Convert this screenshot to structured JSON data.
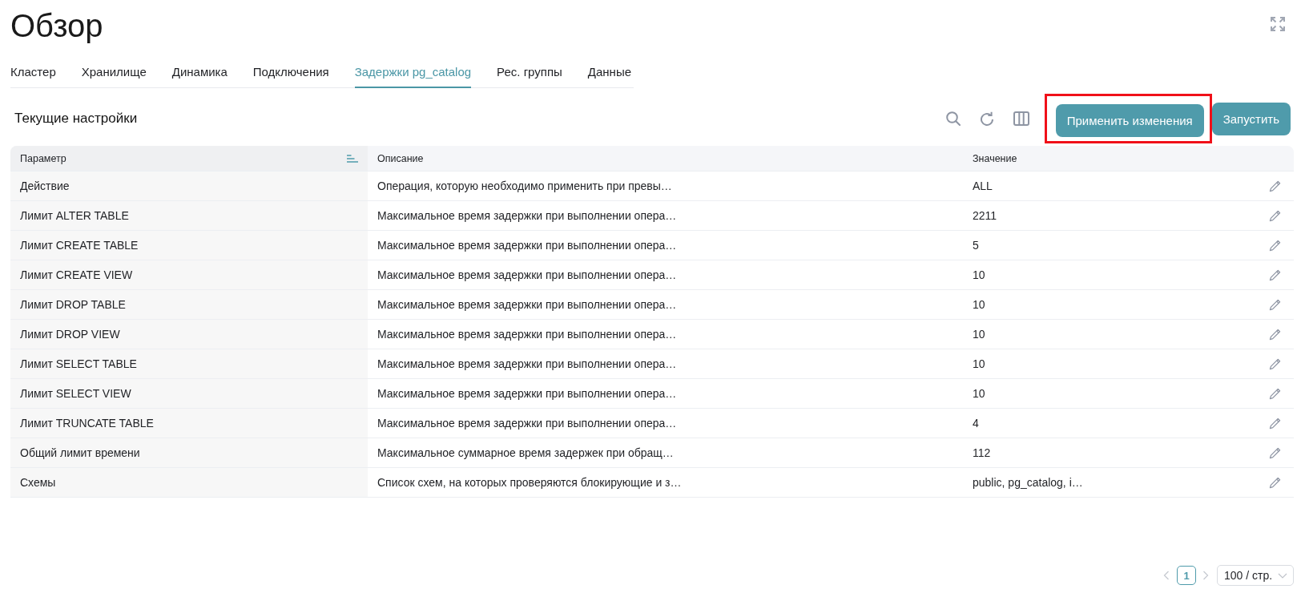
{
  "page": {
    "title": "Обзор"
  },
  "tabs": [
    {
      "label": "Кластер",
      "selected": false
    },
    {
      "label": "Хранилище",
      "selected": false
    },
    {
      "label": "Динамика",
      "selected": false
    },
    {
      "label": "Подключения",
      "selected": false
    },
    {
      "label": "Задержки pg_catalog",
      "selected": true
    },
    {
      "label": "Рес. группы",
      "selected": false
    },
    {
      "label": "Данные",
      "selected": false
    }
  ],
  "section": {
    "title": "Текущие настройки"
  },
  "actions": [
    {
      "label": "Применить изменения",
      "highlighted": true
    },
    {
      "label": "Запустить",
      "highlighted": false
    }
  ],
  "table": {
    "columns": [
      {
        "label": "Параметр",
        "sorted": true
      },
      {
        "label": "Описание",
        "sorted": false
      },
      {
        "label": "Значение",
        "sorted": false
      }
    ],
    "rows": [
      {
        "cells": [
          "Действие",
          "Операция, которую необходимо применить при превы…",
          "ALL"
        ]
      },
      {
        "cells": [
          "Лимит ALTER TABLE",
          "Максимальное время задержки при выполнении опера…",
          "2211"
        ]
      },
      {
        "cells": [
          "Лимит CREATE TABLE",
          "Максимальное время задержки при выполнении опера…",
          "5"
        ]
      },
      {
        "cells": [
          "Лимит CREATE VIEW",
          "Максимальное время задержки при выполнении опера…",
          "10"
        ]
      },
      {
        "cells": [
          "Лимит DROP TABLE",
          "Максимальное время задержки при выполнении опера…",
          "10"
        ]
      },
      {
        "cells": [
          "Лимит DROP VIEW",
          "Максимальное время задержки при выполнении опера…",
          "10"
        ]
      },
      {
        "cells": [
          "Лимит SELECT TABLE",
          "Максимальное время задержки при выполнении опера…",
          "10"
        ]
      },
      {
        "cells": [
          "Лимит SELECT VIEW",
          "Максимальное время задержки при выполнении опера…",
          "10"
        ]
      },
      {
        "cells": [
          "Лимит TRUNCATE TABLE",
          "Максимальное время задержки при выполнении опера…",
          "4"
        ]
      },
      {
        "cells": [
          "Общий лимит времени",
          "Максимальное суммарное время задержек при обращ…",
          "112"
        ]
      },
      {
        "cells": [
          "Схемы",
          "Список схем, на которых проверяются блокирующие и з…",
          "public, pg_catalog, i…"
        ]
      }
    ]
  },
  "pagination": {
    "prev": {
      "disabled": true
    },
    "pages": [
      {
        "label": "1",
        "selected": true
      }
    ],
    "next": {
      "disabled": true
    },
    "page_size": "100 / стр."
  }
}
